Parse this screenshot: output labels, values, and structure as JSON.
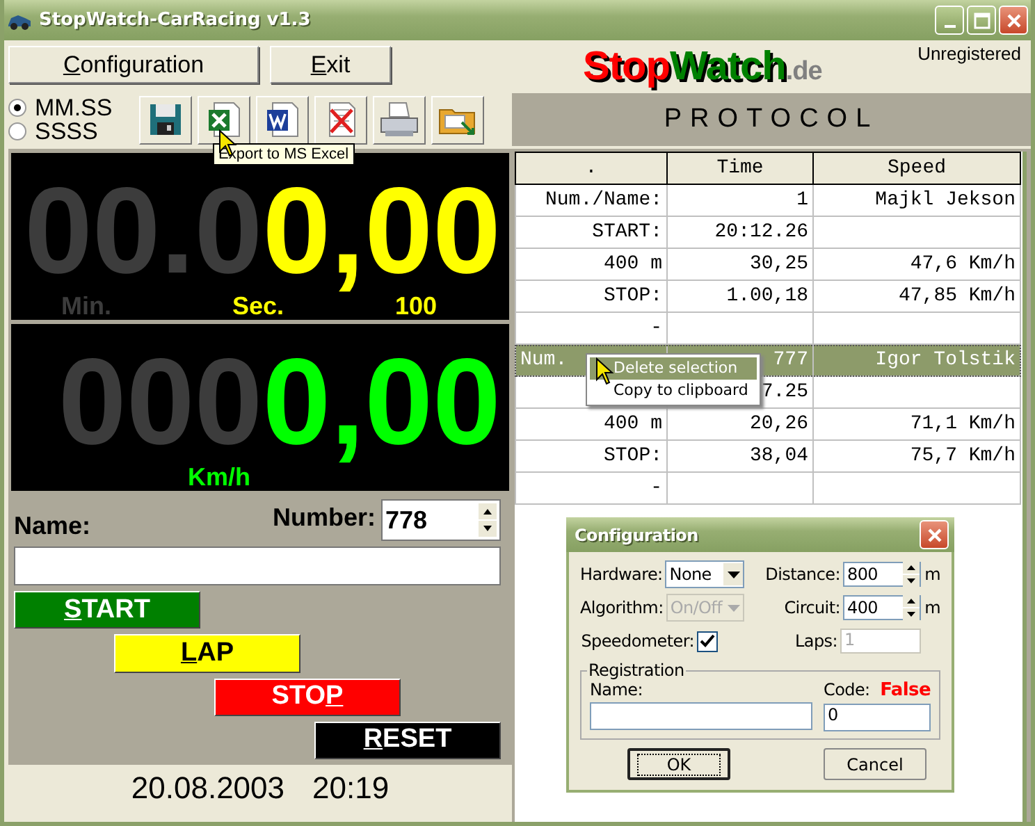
{
  "window": {
    "title": "StopWatch-CarRacing v1.3"
  },
  "menu_buttons": [
    {
      "key": "C",
      "rest": "onfiguration"
    },
    {
      "key": "E",
      "rest": "xit"
    }
  ],
  "logo": [
    {
      "text": "Stop",
      "color": "#ff0000"
    },
    {
      "text": "Watch",
      "color": "#008000"
    },
    {
      "text": ".de",
      "color": "#808080"
    }
  ],
  "registration_status": "Unregistered",
  "time_format": [
    {
      "label": "MM.SS",
      "selected": true
    },
    {
      "label": "SSSS",
      "selected": false
    }
  ],
  "toolbar": [
    {
      "kind": "save"
    },
    {
      "kind": "excel"
    },
    {
      "kind": "word"
    },
    {
      "kind": "delete"
    },
    {
      "kind": "print"
    },
    {
      "kind": "folder"
    }
  ],
  "tooltip": "Export to MS Excel",
  "time_display": {
    "dim": "00.0",
    "lit": "0,00",
    "labels": [
      {
        "text": "Min.",
        "lit": false
      },
      {
        "text": "Sec.",
        "lit": true
      },
      {
        "text": "100",
        "lit": true
      }
    ]
  },
  "speed_display": {
    "dim": "000",
    "lit": "0,00",
    "unit": "Km/h"
  },
  "name_field": {
    "label": "Name:"
  },
  "number_field": {
    "label": "Number:",
    "value": "778"
  },
  "control_buttons": [
    {
      "kind": "start",
      "key": "S",
      "rest": "TART"
    },
    {
      "kind": "lap",
      "key": "L",
      "rest": "AP"
    },
    {
      "kind": "stop",
      "before": "STO",
      "key": "P"
    },
    {
      "kind": "reset",
      "key": "R",
      "rest": "ESET"
    }
  ],
  "status_bar": {
    "date": "20.08.2003",
    "time": "20:19"
  },
  "protocol": {
    "title": "PROTOCOL",
    "columns": [
      ".",
      "Time",
      "Speed"
    ],
    "rows": [
      {
        "cells": [
          "Num./Name:",
          "1",
          "Majkl Jekson"
        ],
        "selected": false
      },
      {
        "cells": [
          "START:",
          "20:12.26",
          null
        ],
        "selected": false
      },
      {
        "cells": [
          "400 m",
          "30,25",
          "47,6 Km/h"
        ],
        "selected": false
      },
      {
        "cells": [
          "STOP:",
          "1.00,18",
          "47,85 Km/h"
        ],
        "selected": false
      },
      {
        "cells": [
          "-",
          null,
          null
        ],
        "selected": false
      },
      {
        "cells": [
          "Num.",
          "777",
          "Igor Tolstik"
        ],
        "selected": true
      },
      {
        "cells": [
          null,
          "7.25",
          null
        ],
        "selected": false
      },
      {
        "cells": [
          "400 m",
          "20,26",
          "71,1 Km/h"
        ],
        "selected": false
      },
      {
        "cells": [
          "STOP:",
          "38,04",
          "75,7 Km/h"
        ],
        "selected": false
      },
      {
        "cells": [
          "-",
          null,
          null
        ],
        "selected": false
      }
    ]
  },
  "context_menu": [
    {
      "label": "Delete selection",
      "selected": true
    },
    {
      "label": "Copy to clipboard",
      "selected": false
    }
  ],
  "config_dialog": {
    "title": "Configuration",
    "selects": [
      {
        "label": "Hardware:",
        "value": "None",
        "disabled": false
      },
      {
        "label": "Algorithm:",
        "value": "On/Off",
        "disabled": true
      }
    ],
    "speedometer": {
      "label": "Speedometer:",
      "checked": true
    },
    "spinners": [
      {
        "label": "Distance:",
        "value": "800",
        "unit": "m"
      },
      {
        "label": "Circuit:",
        "value": "400",
        "unit": "m"
      }
    ],
    "laps": {
      "label": "Laps:",
      "value": "1",
      "disabled": true
    },
    "registration": {
      "title": "Registration",
      "name_label": "Name:",
      "code_label": "Code:",
      "code_status": "False",
      "code_value": "0"
    },
    "buttons": [
      {
        "label": "OK",
        "default": true
      },
      {
        "label": "Cancel",
        "default": false
      }
    ]
  }
}
